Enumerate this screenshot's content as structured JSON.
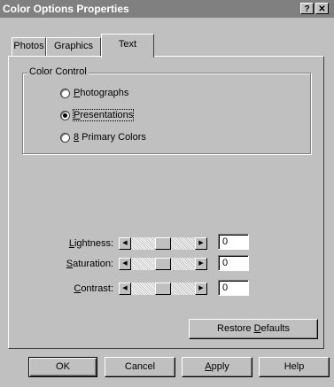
{
  "window": {
    "title": "Color Options Properties",
    "help_button": "?",
    "close_button": "✕"
  },
  "tabs": [
    {
      "label": "Photos"
    },
    {
      "label": "Graphics"
    },
    {
      "label": "Text",
      "active": true
    }
  ],
  "color_control": {
    "group_label": "Color Control",
    "options": [
      {
        "underline": "P",
        "rest": "hotographs",
        "selected": false
      },
      {
        "underline": "P",
        "rest": "resentations",
        "selected": true
      },
      {
        "underline": "8",
        "rest": " Primary Colors",
        "selected": false
      }
    ]
  },
  "sliders": [
    {
      "underline": "L",
      "rest": "ightness:",
      "value": "0",
      "position": 0.5
    },
    {
      "underline": "S",
      "rest": "aturation:",
      "value": "0",
      "position": 0.5
    },
    {
      "underline": "C",
      "rest": "ontrast:",
      "value": "0",
      "position": 0.5
    }
  ],
  "restore_defaults": {
    "prefix": "Restore ",
    "underline": "D",
    "rest": "efaults"
  },
  "footer": {
    "ok": "OK",
    "cancel": "Cancel",
    "apply_underline": "A",
    "apply_rest": "pply",
    "help": "Help"
  },
  "colors": {
    "face": "#c0c0c0",
    "titlebar": "#808080",
    "highlight": "#ffffff",
    "shadow": "#808080"
  }
}
